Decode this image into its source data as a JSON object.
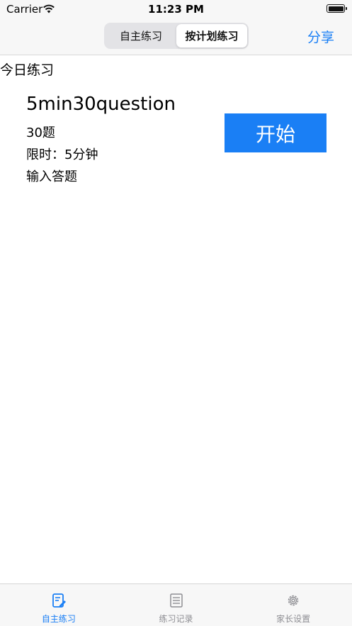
{
  "status_bar": {
    "carrier": "Carrier",
    "time": "11:23 PM"
  },
  "nav": {
    "segments": [
      "自主练习",
      "按计划练习"
    ],
    "selected_segment": 1,
    "share_label": "分享"
  },
  "section_title": "今日练习",
  "plan": {
    "name": "5min30question",
    "count": "30题",
    "time_limit": "限时：5分钟",
    "answer_mode": "输入答题",
    "start_label": "开始"
  },
  "tabs": [
    {
      "label": "自主练习",
      "icon": "practice-edit-icon",
      "active": true
    },
    {
      "label": "练习记录",
      "icon": "list-record-icon",
      "active": false
    },
    {
      "label": "家长设置",
      "icon": "gear-icon",
      "active": false
    }
  ],
  "colors": {
    "accent": "#1a7ff5",
    "inactive": "#8e8e93",
    "bar_background": "#f7f7f7"
  }
}
